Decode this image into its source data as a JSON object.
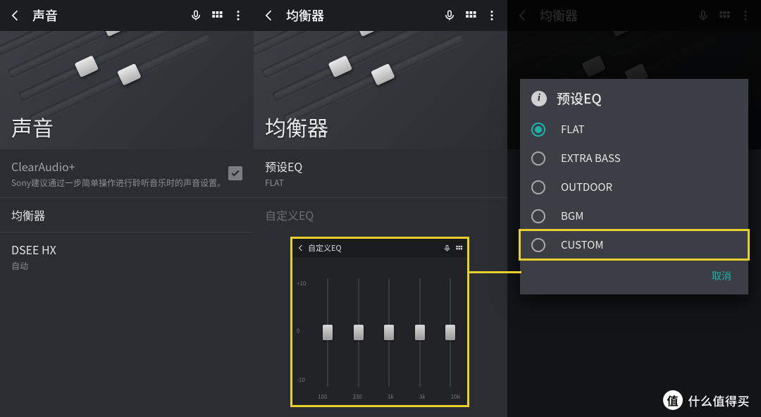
{
  "panel1": {
    "title": "声音",
    "hero_title": "声音",
    "clearaudio": {
      "label": "ClearAudio+",
      "desc": "Sony建议通过一步简单操作进行聆听音乐时的声音设置。",
      "checked": true
    },
    "equalizer": {
      "label": "均衡器"
    },
    "dsee": {
      "label": "DSEE HX",
      "value": "自动"
    }
  },
  "panel2": {
    "title": "均衡器",
    "hero_title": "均衡器",
    "preset": {
      "label": "预设EQ",
      "value": "FLAT"
    },
    "custom_label": "自定义EQ",
    "inset": {
      "title": "自定义EQ",
      "scale": {
        "top": "+10",
        "mid": "0",
        "bot": "-10"
      },
      "bands": [
        {
          "freq": "100",
          "val": 0
        },
        {
          "freq": "330",
          "val": 0
        },
        {
          "freq": "1k",
          "val": 0
        },
        {
          "freq": "3k",
          "val": 0
        },
        {
          "freq": "10k",
          "val": 0
        }
      ]
    }
  },
  "panel3": {
    "title": "均衡器",
    "dialog": {
      "title": "预设EQ",
      "options": [
        "FLAT",
        "EXTRA BASS",
        "OUTDOOR",
        "BGM",
        "CUSTOM"
      ],
      "selected": "FLAT",
      "highlighted": "CUSTOM",
      "cancel": "取消"
    }
  },
  "watermark": {
    "badge": "值",
    "text": "什么值得买"
  }
}
